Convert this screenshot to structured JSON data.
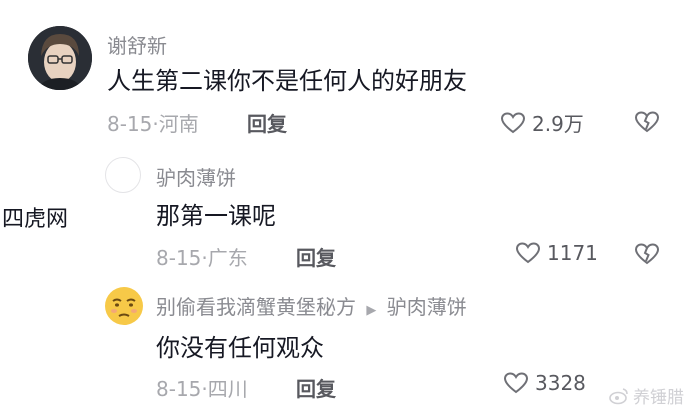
{
  "comments": [
    {
      "author": "谢舒新",
      "text": "人生第二课你不是任何人的好朋友",
      "date": "8-15",
      "sep": "·",
      "location": "河南",
      "reply_label": "回复",
      "likes": "2.9万"
    },
    {
      "author": "驴肉薄饼",
      "text": "那第一课呢",
      "date": "8-15",
      "sep": "·",
      "location": "广东",
      "reply_label": "回复",
      "likes": "1171"
    },
    {
      "author": "别偷看我滴蟹黄堡秘方",
      "reply_arrow": "▶",
      "reply_to": "驴肉薄饼",
      "text": "你没有任何观众",
      "date": "8-15",
      "sep": "·",
      "location": "四川",
      "reply_label": "回复",
      "likes": "3328"
    }
  ],
  "watermarks": {
    "left": "四虎网",
    "right": "养锤腊"
  },
  "colors": {
    "author": "#8a8b91",
    "text": "#161823",
    "meta": "#a7a8ad",
    "icon": "#6f7076"
  },
  "icons": [
    "heart-icon",
    "dislike-heart-icon",
    "emoji-avatar-icon",
    "weibo-icon"
  ]
}
